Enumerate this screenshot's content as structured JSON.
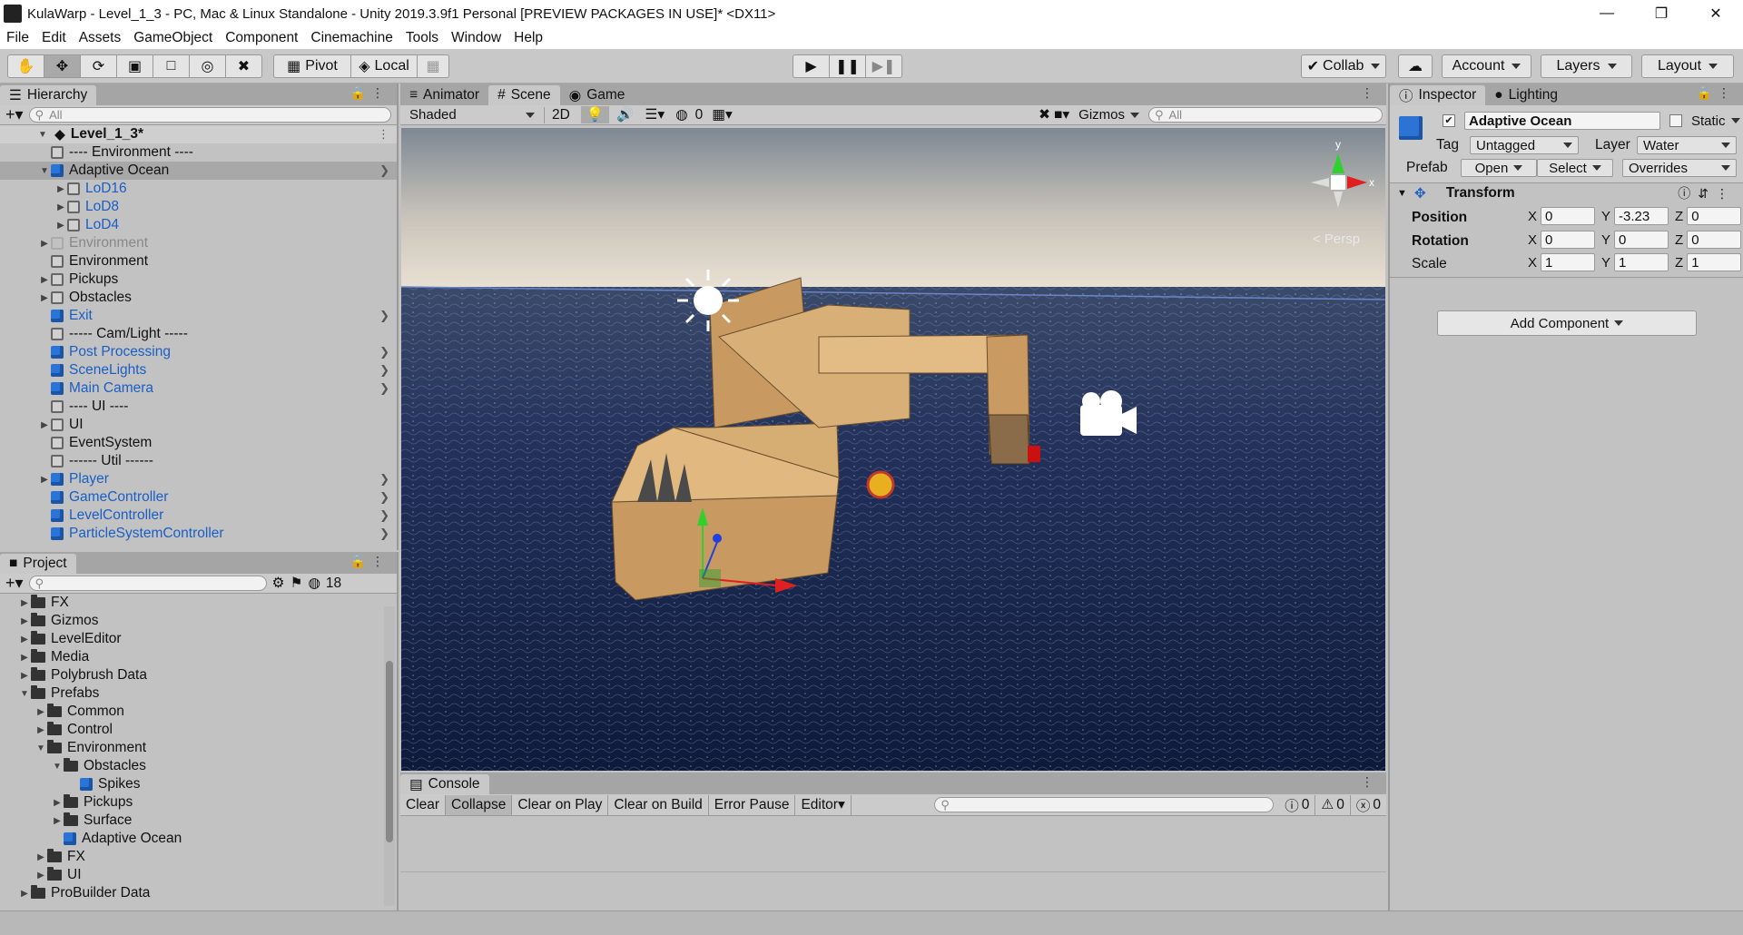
{
  "window": {
    "title": "KulaWarp - Level_1_3 - PC, Mac & Linux Standalone - Unity 2019.3.9f1 Personal [PREVIEW PACKAGES IN USE]* <DX11>"
  },
  "menu": [
    "File",
    "Edit",
    "Assets",
    "GameObject",
    "Component",
    "Cinemachine",
    "Tools",
    "Window",
    "Help"
  ],
  "toolbar": {
    "pivot": "Pivot",
    "local": "Local",
    "collab": "Collab",
    "account": "Account",
    "layers": "Layers",
    "layout": "Layout"
  },
  "hierarchy": {
    "tab": "Hierarchy",
    "search_placeholder": "All",
    "scene": "Level_1_3*",
    "items": [
      {
        "label": "---- Environment ----",
        "depth": 1,
        "icon": "grey",
        "color": "normal",
        "arrow": "",
        "chev": false,
        "sel": false
      },
      {
        "label": "Adaptive Ocean",
        "depth": 1,
        "icon": "blue",
        "color": "normal",
        "arrow": "down",
        "chev": true,
        "sel": true
      },
      {
        "label": "LoD16",
        "depth": 2,
        "icon": "grey",
        "color": "blue",
        "arrow": "right",
        "chev": false,
        "sel": false
      },
      {
        "label": "LoD8",
        "depth": 2,
        "icon": "grey",
        "color": "blue",
        "arrow": "right",
        "chev": false,
        "sel": false
      },
      {
        "label": "LoD4",
        "depth": 2,
        "icon": "grey",
        "color": "blue",
        "arrow": "right",
        "chev": false,
        "sel": false
      },
      {
        "label": "Environment",
        "depth": 1,
        "icon": "faded",
        "color": "faded",
        "arrow": "right",
        "chev": false,
        "sel": false
      },
      {
        "label": "Environment",
        "depth": 1,
        "icon": "grey",
        "color": "normal",
        "arrow": "",
        "chev": false,
        "sel": false
      },
      {
        "label": "Pickups",
        "depth": 1,
        "icon": "grey",
        "color": "normal",
        "arrow": "right",
        "chev": false,
        "sel": false
      },
      {
        "label": "Obstacles",
        "depth": 1,
        "icon": "grey",
        "color": "normal",
        "arrow": "right",
        "chev": false,
        "sel": false
      },
      {
        "label": "Exit",
        "depth": 1,
        "icon": "blue",
        "color": "blue",
        "arrow": "",
        "chev": true,
        "sel": false
      },
      {
        "label": "----- Cam/Light -----",
        "depth": 1,
        "icon": "grey",
        "color": "normal",
        "arrow": "",
        "chev": false,
        "sel": false
      },
      {
        "label": "Post Processing",
        "depth": 1,
        "icon": "blue",
        "color": "blue",
        "arrow": "",
        "chev": true,
        "sel": false
      },
      {
        "label": "SceneLights",
        "depth": 1,
        "icon": "blue",
        "color": "blue",
        "arrow": "",
        "chev": true,
        "sel": false
      },
      {
        "label": "Main Camera",
        "depth": 1,
        "icon": "blue",
        "color": "blue",
        "arrow": "",
        "chev": true,
        "sel": false
      },
      {
        "label": "---- UI ----",
        "depth": 1,
        "icon": "grey",
        "color": "normal",
        "arrow": "",
        "chev": false,
        "sel": false
      },
      {
        "label": "UI",
        "depth": 1,
        "icon": "grey",
        "color": "normal",
        "arrow": "right",
        "chev": false,
        "sel": false
      },
      {
        "label": "EventSystem",
        "depth": 1,
        "icon": "grey",
        "color": "normal",
        "arrow": "",
        "chev": false,
        "sel": false
      },
      {
        "label": "------ Util ------",
        "depth": 1,
        "icon": "grey",
        "color": "normal",
        "arrow": "",
        "chev": false,
        "sel": false
      },
      {
        "label": "Player",
        "depth": 1,
        "icon": "blue",
        "color": "blue",
        "arrow": "right",
        "chev": true,
        "sel": false
      },
      {
        "label": "GameController",
        "depth": 1,
        "icon": "blue",
        "color": "blue",
        "arrow": "",
        "chev": true,
        "sel": false
      },
      {
        "label": "LevelController",
        "depth": 1,
        "icon": "blue",
        "color": "blue",
        "arrow": "",
        "chev": true,
        "sel": false
      },
      {
        "label": "ParticleSystemController",
        "depth": 1,
        "icon": "blue",
        "color": "blue",
        "arrow": "",
        "chev": true,
        "sel": false
      }
    ]
  },
  "project": {
    "tab": "Project",
    "hidden_count": "18",
    "items": [
      {
        "label": "FX",
        "depth": 0,
        "icon": "folder",
        "arrow": "right"
      },
      {
        "label": "Gizmos",
        "depth": 0,
        "icon": "folder",
        "arrow": "right"
      },
      {
        "label": "LevelEditor",
        "depth": 0,
        "icon": "folder",
        "arrow": "right"
      },
      {
        "label": "Media",
        "depth": 0,
        "icon": "folder",
        "arrow": "right"
      },
      {
        "label": "Polybrush Data",
        "depth": 0,
        "icon": "folder",
        "arrow": "right"
      },
      {
        "label": "Prefabs",
        "depth": 0,
        "icon": "folder",
        "arrow": "down"
      },
      {
        "label": "Common",
        "depth": 1,
        "icon": "folder",
        "arrow": "right"
      },
      {
        "label": "Control",
        "depth": 1,
        "icon": "folder",
        "arrow": "right"
      },
      {
        "label": "Environment",
        "depth": 1,
        "icon": "folder",
        "arrow": "down"
      },
      {
        "label": "Obstacles",
        "depth": 2,
        "icon": "folder",
        "arrow": "down"
      },
      {
        "label": "Spikes",
        "depth": 3,
        "icon": "prefab",
        "arrow": ""
      },
      {
        "label": "Pickups",
        "depth": 2,
        "icon": "folder",
        "arrow": "right"
      },
      {
        "label": "Surface",
        "depth": 2,
        "icon": "folder",
        "arrow": "right"
      },
      {
        "label": "Adaptive Ocean",
        "depth": 2,
        "icon": "prefab",
        "arrow": ""
      },
      {
        "label": "FX",
        "depth": 1,
        "icon": "folder",
        "arrow": "right"
      },
      {
        "label": "UI",
        "depth": 1,
        "icon": "folder",
        "arrow": "right"
      },
      {
        "label": "ProBuilder Data",
        "depth": 0,
        "icon": "folder",
        "arrow": "right"
      }
    ]
  },
  "scene_view": {
    "tabs": [
      "Animator",
      "Scene",
      "Game"
    ],
    "shading": "Shaded",
    "mode_2d": "2D",
    "hidden_count": "0",
    "gizmos": "Gizmos",
    "search_placeholder": "All",
    "persp": "< Persp",
    "axis_x": "x",
    "axis_y": "y"
  },
  "console": {
    "tab": "Console",
    "buttons": [
      "Clear",
      "Collapse",
      "Clear on Play",
      "Clear on Build",
      "Error Pause"
    ],
    "editor": "Editor",
    "info_count": "0",
    "warn_count": "0",
    "error_count": "0"
  },
  "inspector": {
    "tabs": [
      "Inspector",
      "Lighting"
    ],
    "name": "Adaptive Ocean",
    "static": "Static",
    "tag_label": "Tag",
    "tag": "Untagged",
    "layer_label": "Layer",
    "layer": "Water",
    "prefab_label": "Prefab",
    "open": "Open",
    "select": "Select",
    "overrides": "Overrides",
    "component": "Transform",
    "position": {
      "label": "Position",
      "x": "0",
      "y": "-3.23",
      "z": "0"
    },
    "rotation": {
      "label": "Rotation",
      "x": "0",
      "y": "0",
      "z": "0"
    },
    "scale": {
      "label": "Scale",
      "x": "1",
      "y": "1",
      "z": "1"
    },
    "add_component": "Add Component"
  }
}
